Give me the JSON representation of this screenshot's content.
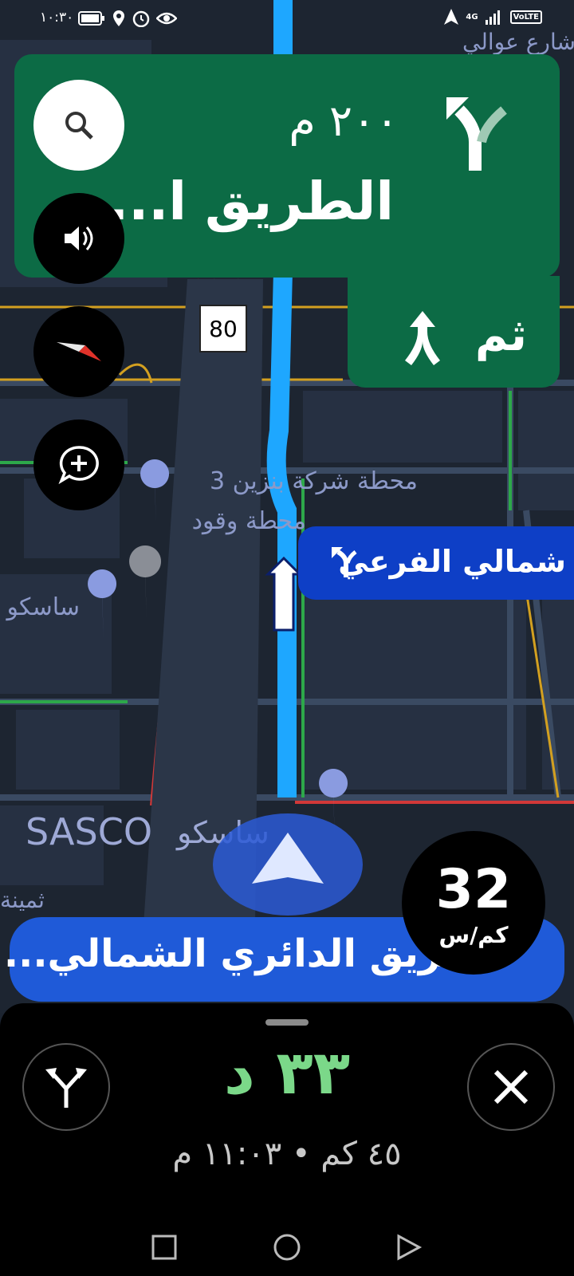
{
  "status_bar": {
    "time": "١٠:٣٠",
    "network": "4G",
    "volte": "VoLTE",
    "icons": [
      "battery-icon",
      "location-icon",
      "alarm-icon",
      "eye-icon",
      "navigation-arrow-icon",
      "signal-icon"
    ]
  },
  "map": {
    "top_street": "شارع عوالي",
    "speed_limit": "80",
    "poi_gas_station": "محطة شركة بنزين 3",
    "poi_fuel": "محطة وقود",
    "poi_sasco_left": "ساسكو",
    "sasco_en": "SASCO",
    "sasco_ar": "ساسكو",
    "small_label": "ثمينة"
  },
  "instruction": {
    "distance": "٢٠٠ م",
    "road": "الطريق ا...",
    "then_label": "ثم",
    "turn_icon": "turn-slight-left-icon",
    "then_icon": "merge-icon"
  },
  "branch_callout": {
    "text": "شمالي الفرعي",
    "icon": "fork-left-icon"
  },
  "current_road": "الطريق الدائري الشمالي...",
  "speedometer": {
    "speed": "32",
    "unit": "كم/س"
  },
  "trip": {
    "minutes": "٣٣ د",
    "summary": "٤٥ كم • ١١:٠٣ م"
  },
  "colors": {
    "nav_green": "#0c6b45",
    "route_blue": "#1ea7ff",
    "eta_green": "#7bd889",
    "current_road_blue": "#1f5ad8"
  }
}
